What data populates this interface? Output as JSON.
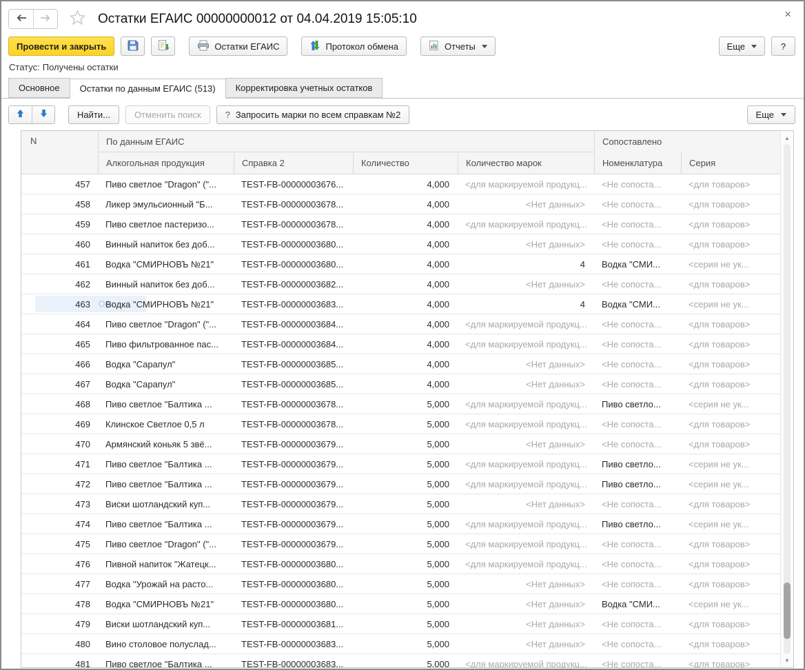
{
  "window": {
    "title": "Остатки ЕГАИС 00000000012 от 04.04.2019 15:05:10",
    "close_label": "×"
  },
  "colors": {
    "accent_yellow": "#fdd84a",
    "muted_text": "#a9a9a9",
    "header_bg": "#f5f5f5",
    "arrow_blue": "#3079c8",
    "arrow_green": "#3fa03f"
  },
  "toolbar": {
    "post_close": "Провести и закрыть",
    "print_button": "Остатки ЕГАИС",
    "protocol_button": "Протокол обмена",
    "reports_button": "Отчеты",
    "more_button": "Еще",
    "help_button": "?"
  },
  "status": {
    "label": "Статус:",
    "value": "Получены остатки"
  },
  "tabs": [
    {
      "label": "Основное"
    },
    {
      "label": "Остатки по данным ЕГАИС (513)"
    },
    {
      "label": "Корректировка учетных остатков"
    }
  ],
  "panel_toolbar": {
    "find_button": "Найти...",
    "cancel_search_button": "Отменить поиск",
    "request_marks_prefix": "?",
    "request_marks_button": "Запросить марки по всем справкам №2",
    "more_button": "Еще"
  },
  "table": {
    "header": {
      "n": "N",
      "group_egais": "По данным ЕГАИС",
      "group_matched": "Сопоставлено",
      "col_product": "Алкогольная продукция",
      "col_spravka": "Справка 2",
      "col_qty": "Количество",
      "col_marks": "Количество марок",
      "col_nomenclature": "Номенклатура",
      "col_series": "Серия"
    },
    "rows": [
      {
        "n": "457",
        "product": "Пиво светлое \"Dragon\" (\"...",
        "spravka": "TEST-FB-00000003676...",
        "qty": "4,000",
        "marks": "<для маркируемой продукц...",
        "nomenclature": "<Не сопоста...",
        "series": "<для товаров>"
      },
      {
        "n": "458",
        "product": "Ликер эмульсионный \"Б...",
        "spravka": "TEST-FB-00000003678...",
        "qty": "4,000",
        "marks": "<Нет данных>",
        "nomenclature": "<Не сопоста...",
        "series": "<для товаров>"
      },
      {
        "n": "459",
        "product": "Пиво светлое пастеризо...",
        "spravka": "TEST-FB-00000003678...",
        "qty": "4,000",
        "marks": "<для маркируемой продукц...",
        "nomenclature": "<Не сопоста...",
        "series": "<для товаров>"
      },
      {
        "n": "460",
        "product": "Винный напиток без доб...",
        "spravka": "TEST-FB-00000003680...",
        "qty": "4,000",
        "marks": "<Нет данных>",
        "nomenclature": "<Не сопоста...",
        "series": "<для товаров>"
      },
      {
        "n": "461",
        "product": "Водка \"СМИРНОВЪ №21\"",
        "spravka": "TEST-FB-00000003680...",
        "qty": "4,000",
        "marks": "4",
        "nomenclature": "Водка \"СМИ...",
        "series": "<серия не ук..."
      },
      {
        "n": "462",
        "product": "Винный напиток без доб...",
        "spravka": "TEST-FB-00000003682...",
        "qty": "4,000",
        "marks": "<Нет данных>",
        "nomenclature": "<Не сопоста...",
        "series": "<для товаров>"
      },
      {
        "n": "463",
        "product": "Водка \"СМИРНОВЪ №21\"",
        "spravka": "TEST-FB-00000003683...",
        "qty": "4,000",
        "marks": "4",
        "nomenclature": "Водка \"СМИ...",
        "series": "<серия не ук...",
        "tooltip": "Осн"
      },
      {
        "n": "464",
        "product": "Пиво светлое \"Dragon\" (\"...",
        "spravka": "TEST-FB-00000003684...",
        "qty": "4,000",
        "marks": "<для маркируемой продукц...",
        "nomenclature": "<Не сопоста...",
        "series": "<для товаров>"
      },
      {
        "n": "465",
        "product": "Пиво фильтрованное пас...",
        "spravka": "TEST-FB-00000003684...",
        "qty": "4,000",
        "marks": "<для маркируемой продукц...",
        "nomenclature": "<Не сопоста...",
        "series": "<для товаров>"
      },
      {
        "n": "466",
        "product": "Водка \"Сарапул\"",
        "spravka": "TEST-FB-00000003685...",
        "qty": "4,000",
        "marks": "<Нет данных>",
        "nomenclature": "<Не сопоста...",
        "series": "<для товаров>"
      },
      {
        "n": "467",
        "product": "Водка \"Сарапул\"",
        "spravka": "TEST-FB-00000003685...",
        "qty": "4,000",
        "marks": "<Нет данных>",
        "nomenclature": "<Не сопоста...",
        "series": "<для товаров>"
      },
      {
        "n": "468",
        "product": "Пиво светлое \"Балтика ...",
        "spravka": "TEST-FB-00000003678...",
        "qty": "5,000",
        "marks": "<для маркируемой продукц...",
        "nomenclature": "Пиво светло...",
        "series": "<серия не ук..."
      },
      {
        "n": "469",
        "product": "Клинское Светлое 0,5 л",
        "spravka": "TEST-FB-00000003678...",
        "qty": "5,000",
        "marks": "<для маркируемой продукц...",
        "nomenclature": "<Не сопоста...",
        "series": "<для товаров>"
      },
      {
        "n": "470",
        "product": "Армянский коньяк 5 звё...",
        "spravka": "TEST-FB-00000003679...",
        "qty": "5,000",
        "marks": "<Нет данных>",
        "nomenclature": "<Не сопоста...",
        "series": "<для товаров>"
      },
      {
        "n": "471",
        "product": "Пиво светлое \"Балтика ...",
        "spravka": "TEST-FB-00000003679...",
        "qty": "5,000",
        "marks": "<для маркируемой продукц...",
        "nomenclature": "Пиво светло...",
        "series": "<серия не ук..."
      },
      {
        "n": "472",
        "product": "Пиво светлое \"Балтика ...",
        "spravka": "TEST-FB-00000003679...",
        "qty": "5,000",
        "marks": "<для маркируемой продукц...",
        "nomenclature": "Пиво светло...",
        "series": "<серия не ук..."
      },
      {
        "n": "473",
        "product": "Виски шотландский куп...",
        "spravka": "TEST-FB-00000003679...",
        "qty": "5,000",
        "marks": "<Нет данных>",
        "nomenclature": "<Не сопоста...",
        "series": "<для товаров>"
      },
      {
        "n": "474",
        "product": "Пиво светлое \"Балтика ...",
        "spravka": "TEST-FB-00000003679...",
        "qty": "5,000",
        "marks": "<для маркируемой продукц...",
        "nomenclature": "Пиво светло...",
        "series": "<серия не ук..."
      },
      {
        "n": "475",
        "product": "Пиво светлое \"Dragon\" (\"...",
        "spravka": "TEST-FB-00000003679...",
        "qty": "5,000",
        "marks": "<для маркируемой продукц...",
        "nomenclature": "<Не сопоста...",
        "series": "<для товаров>"
      },
      {
        "n": "476",
        "product": "Пивной напиток \"Жатецк...",
        "spravka": "TEST-FB-00000003680...",
        "qty": "5,000",
        "marks": "<для маркируемой продукц...",
        "nomenclature": "<Не сопоста...",
        "series": "<для товаров>"
      },
      {
        "n": "477",
        "product": "Водка \"Урожай на расто...",
        "spravka": "TEST-FB-00000003680...",
        "qty": "5,000",
        "marks": "<Нет данных>",
        "nomenclature": "<Не сопоста...",
        "series": "<для товаров>"
      },
      {
        "n": "478",
        "product": "Водка \"СМИРНОВЪ №21\"",
        "spravka": "TEST-FB-00000003680...",
        "qty": "5,000",
        "marks": "<Нет данных>",
        "nomenclature": "Водка \"СМИ...",
        "series": "<серия не ук..."
      },
      {
        "n": "479",
        "product": "Виски шотландский куп...",
        "spravka": "TEST-FB-00000003681...",
        "qty": "5,000",
        "marks": "<Нет данных>",
        "nomenclature": "<Не сопоста...",
        "series": "<для товаров>"
      },
      {
        "n": "480",
        "product": "Вино столовое полуслад...",
        "spravka": "TEST-FB-00000003683...",
        "qty": "5,000",
        "marks": "<Нет данных>",
        "nomenclature": "<Не сопоста...",
        "series": "<для товаров>"
      }
    ],
    "partial_row": {
      "n": "481",
      "product": "Пиво светлое \"Балтика ...",
      "spravka": "TEST-FB-00000003683...",
      "qty": "5,000",
      "marks": "<для маркируемой продукц...",
      "nomenclature": "<Не сопоста...",
      "series": "<для товаров>"
    }
  }
}
